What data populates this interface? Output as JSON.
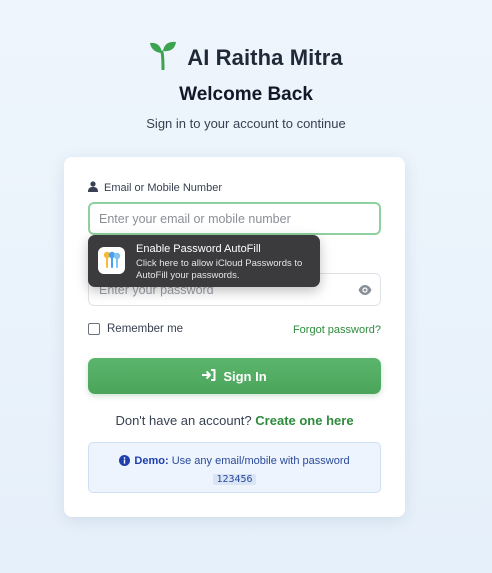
{
  "brand": {
    "name": "AI Raitha Mitra",
    "logo_icon": "sprout-icon",
    "logo_color": "#3ca34f"
  },
  "header": {
    "title": "Welcome Back",
    "subtitle": "Sign in to your account to continue"
  },
  "form": {
    "email_label": "Email or Mobile Number",
    "email_placeholder": "Enter your email or mobile number",
    "email_value": "",
    "password_placeholder": "Enter your password",
    "password_value": "",
    "remember_label": "Remember me",
    "remember_checked": false,
    "forgot_link": "Forgot password?",
    "signin_label": "Sign In"
  },
  "signup": {
    "prompt": "Don't have an account?",
    "link": "Create one here"
  },
  "demo": {
    "label": "Demo:",
    "text": "Use any email/mobile with password",
    "password": "123456"
  },
  "autofill_popup": {
    "title": "Enable Password AutoFill",
    "description": "Click here to allow iCloud Passwords to AutoFill your passwords."
  },
  "colors": {
    "accent_green": "#4aa55b",
    "link_green": "#2e8b3d",
    "focus_border": "#8fd19e",
    "demo_blue": "#1e40af"
  }
}
